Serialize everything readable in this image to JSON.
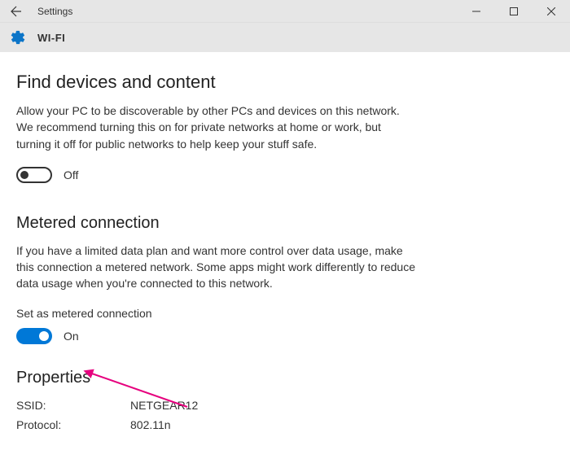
{
  "window": {
    "title": "Settings"
  },
  "page": {
    "header": "WI-FI"
  },
  "find_devices": {
    "heading": "Find devices and content",
    "description": "Allow your PC to be discoverable by other PCs and devices on this network. We recommend turning this on for private networks at home or work, but turning it off for public networks to help keep your stuff safe.",
    "toggle_state": "Off"
  },
  "metered": {
    "heading": "Metered connection",
    "description": "If you have a limited data plan and want more control over data usage, make this connection a metered network. Some apps might work differently to reduce data usage when you're connected to this network.",
    "field_label": "Set as metered connection",
    "toggle_state": "On"
  },
  "properties": {
    "heading": "Properties",
    "rows": [
      {
        "key": "SSID:",
        "value": "NETGEAR12"
      },
      {
        "key": "Protocol:",
        "value": "802.11n"
      }
    ]
  }
}
